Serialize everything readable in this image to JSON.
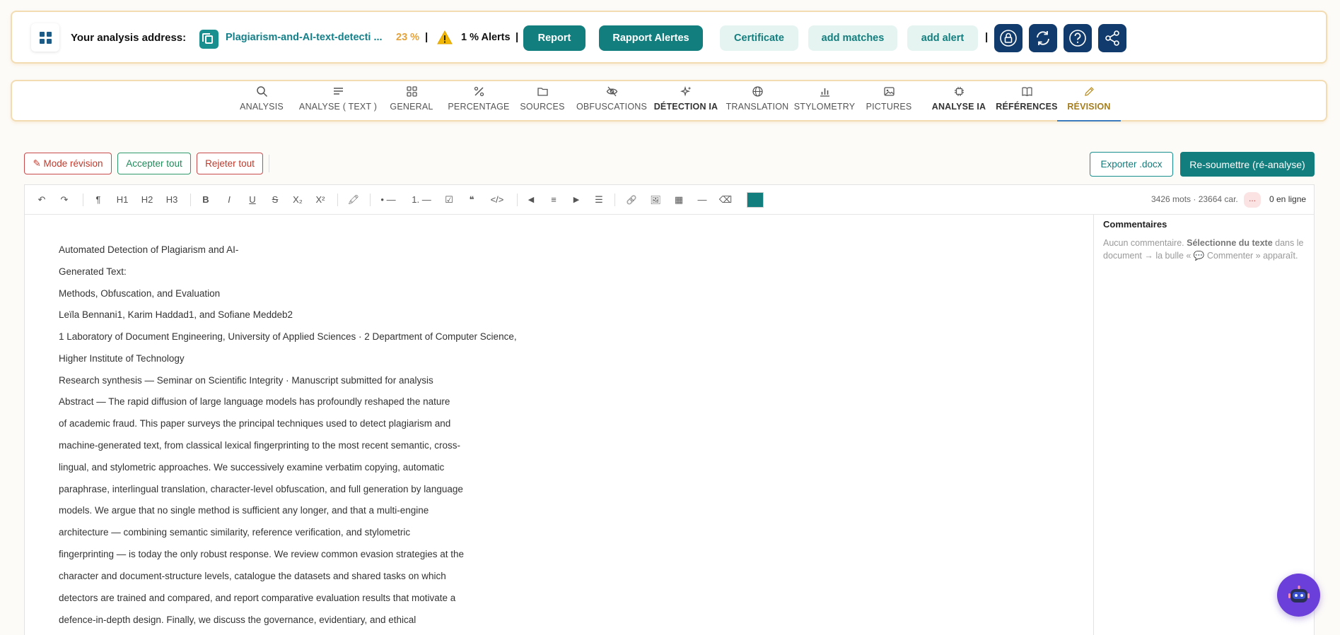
{
  "topbar": {
    "address_label": "Your analysis address:",
    "address_link": "Plagiarism-and-AI-text-detecti ...",
    "percent": "23 %",
    "separator": "|",
    "alerts": "1 % Alerts",
    "buttons": {
      "report": "Report",
      "rapport_alertes": "Rapport Alertes",
      "certificate": "Certificate",
      "add_matches": "add matches",
      "add_alert": "add alert"
    },
    "icon_buttons": [
      "lock-icon",
      "refresh-icon",
      "help-icon",
      "share-icon"
    ]
  },
  "tabs": [
    {
      "label": "ANALYSIS",
      "icon": "search-icon"
    },
    {
      "label": "ANALYSE ( TEXT )",
      "icon": "text-lines-icon"
    },
    {
      "label": "GENERAL",
      "icon": "grid-icon"
    },
    {
      "label": "PERCENTAGE",
      "icon": "percent-icon"
    },
    {
      "label": "SOURCES",
      "icon": "folder-icon"
    },
    {
      "label": "OBFUSCATIONS",
      "icon": "eye-off-icon"
    },
    {
      "label": "DÉTECTION IA",
      "icon": "sparkle-icon"
    },
    {
      "label": "TRANSLATION",
      "icon": "globe-icon"
    },
    {
      "label": "STYLOMETRY",
      "icon": "bar-chart-icon"
    },
    {
      "label": "PICTURES",
      "icon": "image-icon"
    },
    {
      "label": "ANALYSE IA",
      "icon": "chip-icon"
    },
    {
      "label": "RÉFÉRENCES",
      "icon": "book-icon"
    },
    {
      "label": "RÉVISION",
      "icon": "pencil-icon",
      "active": true
    }
  ],
  "actions": {
    "mode_revision": "✎ Mode révision",
    "accept_all": "Accepter tout",
    "reject_all": "Rejeter tout",
    "export_docx": "Exporter .docx",
    "resubmit": "Re-soumettre (ré-analyse)"
  },
  "toolbar": {
    "undo": "↶",
    "redo": "↷",
    "paragraph": "¶",
    "h1": "H1",
    "h2": "H2",
    "h3": "H3",
    "bold": "B",
    "italic": "I",
    "underline": "U",
    "strike": "S",
    "subscript": "X₂",
    "superscript": "X²",
    "highlight": "🖍",
    "bullet_list": "• —",
    "ordered_list": "1. —",
    "checklist": "☑",
    "quote": "❝",
    "code": "</>",
    "align_left": "◀",
    "align_center": "≡",
    "align_right": "▶",
    "align_justify": "☰",
    "link": "🔗",
    "image": "🖼",
    "table": "▦",
    "hr": "—",
    "clear": "⌫",
    "swatch_color": "#137e7e",
    "stats": "3426 mots · 23664 car.",
    "presence": "...",
    "online": "0 en ligne"
  },
  "document": {
    "lines": [
      "Automated Detection of Plagiarism and AI-",
      "Generated Text:",
      "Methods, Obfuscation, and Evaluation",
      "Leïla Bennani1, Karim Haddad1, and Sofiane Meddeb2",
      "1 Laboratory of Document Engineering, University of Applied Sciences · 2 Department of Computer Science,",
      "Higher Institute of Technology",
      "Research synthesis — Seminar on Scientific Integrity · Manuscript submitted for analysis",
      "Abstract — The rapid diffusion of large language models has profoundly reshaped the nature",
      "of academic fraud. This paper surveys the principal techniques used to detect plagiarism and",
      "machine-generated text, from classical lexical fingerprinting to the most recent semantic, cross-",
      "lingual, and stylometric approaches. We successively examine verbatim copying, automatic",
      "paraphrase, interlingual translation, character-level obfuscation, and full generation by language",
      "models. We argue that no single method is sufficient any longer, and that a multi-engine",
      "architecture — combining semantic similarity, reference verification, and stylometric",
      "fingerprinting — is today the only robust response. We review common evasion strategies at the",
      "character and document-structure levels, catalogue the datasets and shared tasks on which",
      "detectors are trained and compared, and report comparative evaluation results that motivate a",
      "defence-in-depth design. Finally, we discuss the governance, evidentiary, and ethical"
    ]
  },
  "comments": {
    "title": "Commentaires",
    "empty_a": "Aucun commentaire. ",
    "empty_b": "Sélectionne du texte",
    "empty_c": " dans le document → la bulle « 💬 Commenter » apparaît."
  },
  "assistant": {
    "icon": "robot-icon"
  }
}
